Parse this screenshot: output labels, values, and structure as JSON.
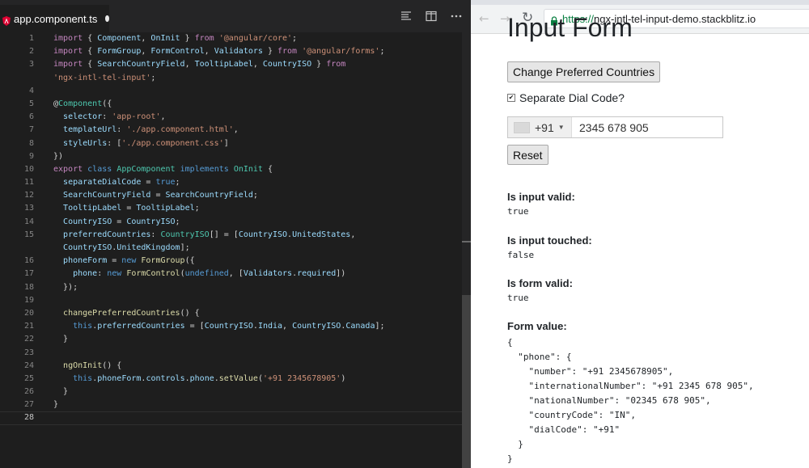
{
  "editor": {
    "tab": {
      "filename": "app.component.ts",
      "icon": "angular-icon"
    },
    "actions": [
      "open-preview-icon",
      "split-editor-icon",
      "more-icon"
    ],
    "current_line": 28,
    "lines": [
      {
        "n": 1,
        "tokens": [
          [
            "kw",
            "import"
          ],
          [
            "pu",
            " { "
          ],
          [
            "vr",
            "Component"
          ],
          [
            "pu",
            ", "
          ],
          [
            "vr",
            "OnInit"
          ],
          [
            "pu",
            " } "
          ],
          [
            "kw",
            "from"
          ],
          [
            "pu",
            " "
          ],
          [
            "st",
            "'@angular/core'"
          ],
          [
            "pu",
            ";"
          ]
        ]
      },
      {
        "n": 2,
        "tokens": [
          [
            "kw",
            "import"
          ],
          [
            "pu",
            " { "
          ],
          [
            "vr",
            "FormGroup"
          ],
          [
            "pu",
            ", "
          ],
          [
            "vr",
            "FormControl"
          ],
          [
            "pu",
            ", "
          ],
          [
            "vr",
            "Validators"
          ],
          [
            "pu",
            " } "
          ],
          [
            "kw",
            "from"
          ],
          [
            "pu",
            " "
          ],
          [
            "st",
            "'@angular/forms'"
          ],
          [
            "pu",
            ";"
          ]
        ]
      },
      {
        "n": 3,
        "tokens": [
          [
            "kw",
            "import"
          ],
          [
            "pu",
            " { "
          ],
          [
            "vr",
            "SearchCountryField"
          ],
          [
            "pu",
            ", "
          ],
          [
            "vr",
            "TooltipLabel"
          ],
          [
            "pu",
            ", "
          ],
          [
            "vr",
            "CountryISO"
          ],
          [
            "pu",
            " } "
          ],
          [
            "kw",
            "from"
          ]
        ]
      },
      {
        "n": null,
        "tokens": [
          [
            "st",
            "'ngx-intl-tel-input'"
          ],
          [
            "pu",
            ";"
          ]
        ]
      },
      {
        "n": 4,
        "tokens": []
      },
      {
        "n": 5,
        "tokens": [
          [
            "pu",
            "@"
          ],
          [
            "ty",
            "Component"
          ],
          [
            "pu",
            "({"
          ]
        ]
      },
      {
        "n": 6,
        "tokens": [
          [
            "pu",
            "  "
          ],
          [
            "vr",
            "selector"
          ],
          [
            "pu",
            ": "
          ],
          [
            "st",
            "'app-root'"
          ],
          [
            "pu",
            ","
          ]
        ]
      },
      {
        "n": 7,
        "tokens": [
          [
            "pu",
            "  "
          ],
          [
            "vr",
            "templateUrl"
          ],
          [
            "pu",
            ": "
          ],
          [
            "st",
            "'./app.component.html'"
          ],
          [
            "pu",
            ","
          ]
        ]
      },
      {
        "n": 8,
        "tokens": [
          [
            "pu",
            "  "
          ],
          [
            "vr",
            "styleUrls"
          ],
          [
            "pu",
            ": ["
          ],
          [
            "st",
            "'./app.component.css'"
          ],
          [
            "pu",
            "]"
          ]
        ]
      },
      {
        "n": 9,
        "tokens": [
          [
            "pu",
            "})"
          ]
        ]
      },
      {
        "n": 10,
        "tokens": [
          [
            "kw",
            "export"
          ],
          [
            "pu",
            " "
          ],
          [
            "kw2",
            "class"
          ],
          [
            "pu",
            " "
          ],
          [
            "ty",
            "AppComponent"
          ],
          [
            "pu",
            " "
          ],
          [
            "kw2",
            "implements"
          ],
          [
            "pu",
            " "
          ],
          [
            "ty",
            "OnInit"
          ],
          [
            "pu",
            " {"
          ]
        ]
      },
      {
        "n": 11,
        "tokens": [
          [
            "pu",
            "  "
          ],
          [
            "vr",
            "separateDialCode"
          ],
          [
            "pu",
            " = "
          ],
          [
            "kw2",
            "true"
          ],
          [
            "pu",
            ";"
          ]
        ]
      },
      {
        "n": 12,
        "tokens": [
          [
            "pu",
            "  "
          ],
          [
            "vr",
            "SearchCountryField"
          ],
          [
            "pu",
            " = "
          ],
          [
            "vr",
            "SearchCountryField"
          ],
          [
            "pu",
            ";"
          ]
        ]
      },
      {
        "n": 13,
        "tokens": [
          [
            "pu",
            "  "
          ],
          [
            "vr",
            "TooltipLabel"
          ],
          [
            "pu",
            " = "
          ],
          [
            "vr",
            "TooltipLabel"
          ],
          [
            "pu",
            ";"
          ]
        ]
      },
      {
        "n": 14,
        "tokens": [
          [
            "pu",
            "  "
          ],
          [
            "vr",
            "CountryISO"
          ],
          [
            "pu",
            " = "
          ],
          [
            "vr",
            "CountryISO"
          ],
          [
            "pu",
            ";"
          ]
        ]
      },
      {
        "n": 15,
        "tokens": [
          [
            "pu",
            "  "
          ],
          [
            "vr",
            "preferredCountries"
          ],
          [
            "pu",
            ": "
          ],
          [
            "ty",
            "CountryISO"
          ],
          [
            "pu",
            "[] = ["
          ],
          [
            "vr",
            "CountryISO"
          ],
          [
            "pu",
            "."
          ],
          [
            "vr",
            "UnitedStates"
          ],
          [
            "pu",
            ","
          ]
        ]
      },
      {
        "n": null,
        "tokens": [
          [
            "pu",
            "  "
          ],
          [
            "vr",
            "CountryISO"
          ],
          [
            "pu",
            "."
          ],
          [
            "vr",
            "UnitedKingdom"
          ],
          [
            "pu",
            "];"
          ]
        ]
      },
      {
        "n": 16,
        "tokens": [
          [
            "pu",
            "  "
          ],
          [
            "vr",
            "phoneForm"
          ],
          [
            "pu",
            " = "
          ],
          [
            "kw2",
            "new"
          ],
          [
            "pu",
            " "
          ],
          [
            "fn",
            "FormGroup"
          ],
          [
            "pu",
            "({"
          ]
        ]
      },
      {
        "n": 17,
        "tokens": [
          [
            "pu",
            "    "
          ],
          [
            "vr",
            "phone"
          ],
          [
            "pu",
            ": "
          ],
          [
            "kw2",
            "new"
          ],
          [
            "pu",
            " "
          ],
          [
            "fn",
            "FormControl"
          ],
          [
            "pu",
            "("
          ],
          [
            "kw2",
            "undefined"
          ],
          [
            "pu",
            ", ["
          ],
          [
            "vr",
            "Validators"
          ],
          [
            "pu",
            "."
          ],
          [
            "vr",
            "required"
          ],
          [
            "pu",
            "])"
          ]
        ]
      },
      {
        "n": 18,
        "tokens": [
          [
            "pu",
            "  });"
          ]
        ]
      },
      {
        "n": 19,
        "tokens": []
      },
      {
        "n": 20,
        "tokens": [
          [
            "pu",
            "  "
          ],
          [
            "fn",
            "changePreferredCountries"
          ],
          [
            "pu",
            "() {"
          ]
        ]
      },
      {
        "n": 21,
        "tokens": [
          [
            "pu",
            "    "
          ],
          [
            "kw2",
            "this"
          ],
          [
            "pu",
            "."
          ],
          [
            "vr",
            "preferredCountries"
          ],
          [
            "pu",
            " = ["
          ],
          [
            "vr",
            "CountryISO"
          ],
          [
            "pu",
            "."
          ],
          [
            "vr",
            "India"
          ],
          [
            "pu",
            ", "
          ],
          [
            "vr",
            "CountryISO"
          ],
          [
            "pu",
            "."
          ],
          [
            "vr",
            "Canada"
          ],
          [
            "pu",
            "];"
          ]
        ]
      },
      {
        "n": 22,
        "tokens": [
          [
            "pu",
            "  }"
          ]
        ]
      },
      {
        "n": 23,
        "tokens": []
      },
      {
        "n": 24,
        "tokens": [
          [
            "pu",
            "  "
          ],
          [
            "fn",
            "ngOnInit"
          ],
          [
            "pu",
            "() {"
          ]
        ]
      },
      {
        "n": 25,
        "tokens": [
          [
            "pu",
            "    "
          ],
          [
            "kw2",
            "this"
          ],
          [
            "pu",
            "."
          ],
          [
            "vr",
            "phoneForm"
          ],
          [
            "pu",
            "."
          ],
          [
            "vr",
            "controls"
          ],
          [
            "pu",
            "."
          ],
          [
            "vr",
            "phone"
          ],
          [
            "pu",
            "."
          ],
          [
            "fn",
            "setValue"
          ],
          [
            "pu",
            "("
          ],
          [
            "st",
            "'+91 2345678905'"
          ],
          [
            "pu",
            ")"
          ]
        ]
      },
      {
        "n": 26,
        "tokens": [
          [
            "pu",
            "  }"
          ]
        ]
      },
      {
        "n": 27,
        "tokens": [
          [
            "pu",
            "}"
          ]
        ]
      },
      {
        "n": 28,
        "tokens": []
      }
    ]
  },
  "browser": {
    "url_scheme": "https://",
    "url_rest": "ngx-intl-tel-input-demo.stackblitz.io",
    "page": {
      "title": "Input Form",
      "change_button": "Change Preferred Countries",
      "separate_label": "Separate Dial Code?",
      "separate_checked": true,
      "dial_code": "+91",
      "phone_value": "2345 678 905",
      "reset_button": "Reset",
      "valid_label": "Is input valid:",
      "valid_value": "true",
      "touched_label": "Is input touched:",
      "touched_value": "false",
      "form_valid_label": "Is form valid:",
      "form_valid_value": "true",
      "form_value_label": "Form value:",
      "form_value_json": "{\n  \"phone\": {\n    \"number\": \"+91 2345678905\",\n    \"internationalNumber\": \"+91 2345 678 905\",\n    \"nationalNumber\": \"02345 678 905\",\n    \"countryCode\": \"IN\",\n    \"dialCode\": \"+91\"\n  }\n}"
    }
  }
}
